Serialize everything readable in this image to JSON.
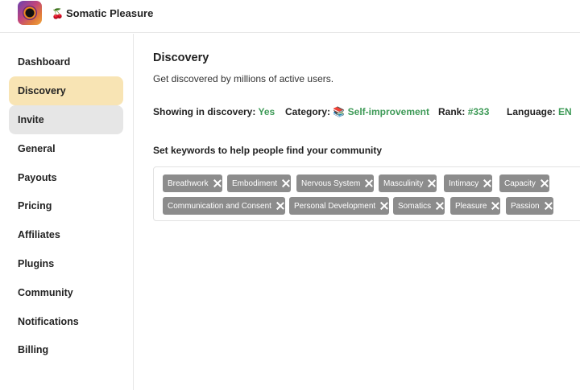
{
  "header": {
    "community_emoji": "🍒",
    "community_name": "Somatic Pleasure"
  },
  "sidebar": {
    "items": [
      {
        "label": "Dashboard"
      },
      {
        "label": "Discovery"
      },
      {
        "label": "Invite"
      },
      {
        "label": "General"
      },
      {
        "label": "Payouts"
      },
      {
        "label": "Pricing"
      },
      {
        "label": "Affiliates"
      },
      {
        "label": "Plugins"
      },
      {
        "label": "Community"
      },
      {
        "label": "Notifications"
      },
      {
        "label": "Billing"
      }
    ],
    "active_item": "Discovery",
    "hovered_item": "Invite"
  },
  "main": {
    "title": "Discovery",
    "subtitle": "Get discovered by millions of active users.",
    "stats": {
      "showing_label": "Showing in discovery:",
      "showing_value": "Yes",
      "category_label": "Category:",
      "category_emoji": "📚",
      "category_value": "Self-improvement",
      "rank_label": "Rank:",
      "rank_value": "#333",
      "language_label": "Language:",
      "language_value": "EN"
    },
    "keywords_label": "Set keywords to help people find your community",
    "keywords": [
      "Breathwork",
      "Embodiment",
      "Nervous System",
      "Masculinity",
      "Intimacy",
      "Capacity",
      "Communication and Consent",
      "Personal Development",
      "Somatics",
      "Pleasure",
      "Passion"
    ]
  },
  "colors": {
    "active_nav_bg": "#f8e4b4",
    "hover_nav_bg": "#e6e6e6",
    "accent_green": "#3e9a57",
    "tag_bg": "#8c8c8c"
  }
}
